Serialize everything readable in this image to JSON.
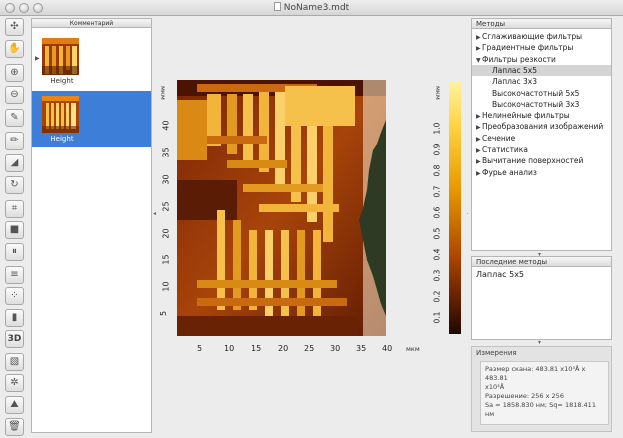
{
  "window": {
    "title": "NoName3.mdt"
  },
  "toolbar": {
    "tools": [
      {
        "name": "move-tool",
        "glyph": "✣"
      },
      {
        "name": "hand-tool",
        "glyph": "✋"
      },
      {
        "name": "zoom-in-tool",
        "glyph": "⊕"
      },
      {
        "name": "zoom-out-tool",
        "glyph": "⊖"
      },
      {
        "name": "pipette-tool",
        "glyph": "✎"
      },
      {
        "name": "pencil-tool",
        "glyph": "✏"
      },
      {
        "name": "ruler-tool",
        "glyph": "◢"
      },
      {
        "name": "rotate-tool",
        "glyph": "↻"
      },
      {
        "name": "crop-tool",
        "glyph": "⌗"
      },
      {
        "name": "square-tool",
        "glyph": "■"
      },
      {
        "name": "columns-tool",
        "glyph": "⏸"
      },
      {
        "name": "rows-tool",
        "glyph": "≡"
      },
      {
        "name": "grid-tool",
        "glyph": "⁘"
      },
      {
        "name": "palette-tool",
        "glyph": "▮"
      },
      {
        "name": "3d-view-tool",
        "glyph": "3D"
      },
      {
        "name": "image-settings-tool",
        "glyph": "▧"
      },
      {
        "name": "settings-tool",
        "glyph": "✲"
      },
      {
        "name": "surface-tool",
        "glyph": "⛰"
      },
      {
        "name": "trash-tool",
        "glyph": "🗑"
      }
    ]
  },
  "thumbnails": {
    "header": "Комментарий",
    "items": [
      {
        "label": "Height",
        "selected": false
      },
      {
        "label": "Height",
        "selected": true
      }
    ]
  },
  "image": {
    "y_unit": "мкм",
    "x_unit": "мкм",
    "y_ticks": [
      "40",
      "35",
      "30",
      "25",
      "20",
      "15",
      "10",
      "5"
    ],
    "x_ticks": [
      "5",
      "10",
      "15",
      "20",
      "25",
      "30",
      "35",
      "40"
    ],
    "colorbar_unit": "мкм",
    "colorbar_ticks": [
      "1.0",
      "0.9",
      "0.8",
      "0.7",
      "0.6",
      "0.5",
      "0.4",
      "0.3",
      "0.2",
      "0.1"
    ]
  },
  "methods": {
    "header": "Методы",
    "items": [
      {
        "label": "Сглаживающие фильтры",
        "tri": "▶",
        "child": false,
        "selected": false
      },
      {
        "label": "Градиентные фильтры",
        "tri": "▶",
        "child": false,
        "selected": false
      },
      {
        "label": "Фильтры резкости",
        "tri": "▼",
        "child": false,
        "selected": false
      },
      {
        "label": "Лаплас 5x5",
        "tri": "",
        "child": true,
        "selected": true
      },
      {
        "label": "Лаплас 3x3",
        "tri": "",
        "child": true,
        "selected": false
      },
      {
        "label": "Высокочастотный 5x5",
        "tri": "",
        "child": true,
        "selected": false
      },
      {
        "label": "Высокочастотный 3x3",
        "tri": "",
        "child": true,
        "selected": false
      },
      {
        "label": "Нелинейные фильтры",
        "tri": "▶",
        "child": false,
        "selected": false
      },
      {
        "label": "Преобразования изображений",
        "tri": "▶",
        "child": false,
        "selected": false
      },
      {
        "label": "Сечение",
        "tri": "▶",
        "child": false,
        "selected": false
      },
      {
        "label": "Статистика",
        "tri": "▶",
        "child": false,
        "selected": false
      },
      {
        "label": "Вычитание поверхностей",
        "tri": "▶",
        "child": false,
        "selected": false
      },
      {
        "label": "Фурье анализ",
        "tri": "▶",
        "child": false,
        "selected": false
      }
    ]
  },
  "recent": {
    "header": "Последние методы",
    "item": "Лаплас 5x5"
  },
  "measure": {
    "header": "Измерения",
    "line1": "Размер скана: 483.81 x10³Å x 483.81",
    "line2": "x10³Å",
    "line3": "Разрешение: 256 x 256",
    "line4": "Sa = 1858.830 нм; Sq= 1818.411 нм"
  }
}
